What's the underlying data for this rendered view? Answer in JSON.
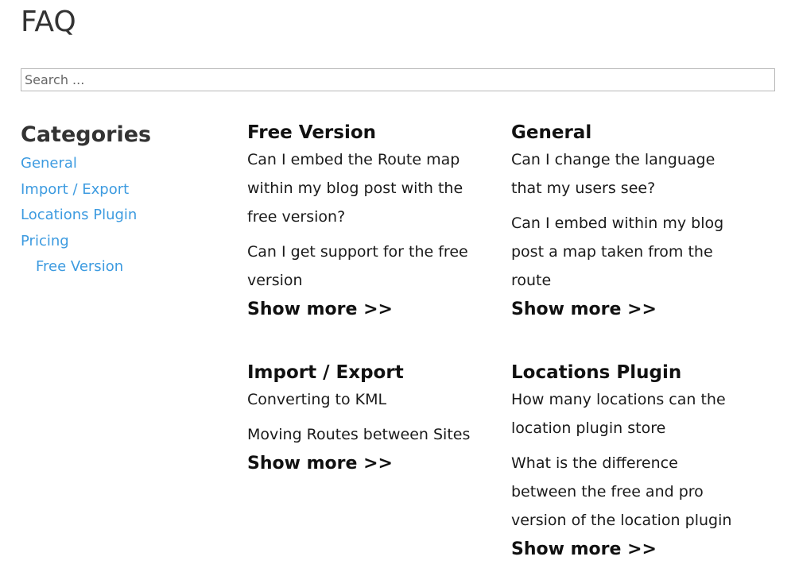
{
  "page": {
    "title": "FAQ",
    "search_placeholder": "Search ..."
  },
  "categories": {
    "heading": "Categories",
    "items": [
      {
        "label": "General"
      },
      {
        "label": "Import / Export"
      },
      {
        "label": "Locations Plugin"
      },
      {
        "label": "Pricing"
      },
      {
        "label": "Free Version",
        "sub": true
      }
    ]
  },
  "sections": {
    "free_version": {
      "title": "Free Version",
      "questions": [
        "Can I embed the Route map within my blog post with the free version?",
        "Can I get support for the free version"
      ],
      "show_more": "Show more >>"
    },
    "general": {
      "title": "General",
      "questions": [
        "Can I change the language that my users see?",
        "Can I embed within my blog post a map taken from the route"
      ],
      "show_more": "Show more >>"
    },
    "import_export": {
      "title": "Import / Export",
      "questions": [
        "Converting to KML",
        "Moving Routes between Sites"
      ],
      "show_more": "Show more >>"
    },
    "locations_plugin": {
      "title": "Locations Plugin",
      "questions": [
        "How many locations can the location plugin store",
        "What is the difference between the free and pro version of the location plugin"
      ],
      "show_more": "Show more >>"
    }
  }
}
